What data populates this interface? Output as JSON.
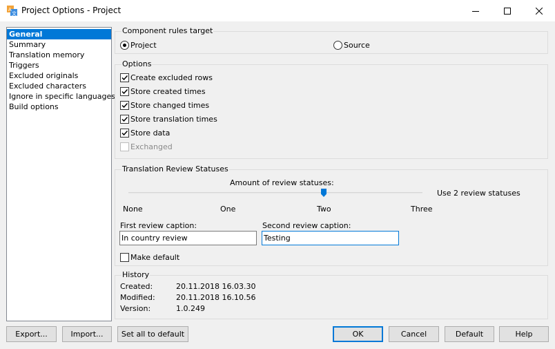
{
  "window": {
    "title": "Project Options - Project"
  },
  "nav": {
    "items": [
      "General",
      "Summary",
      "Translation memory",
      "Triggers",
      "Excluded originals",
      "Excluded characters",
      "Ignore in specific languages",
      "Build options"
    ],
    "selected_index": 0
  },
  "component_rules": {
    "title": "Component rules target",
    "options": [
      "Project",
      "Source"
    ],
    "selected": "Project"
  },
  "options": {
    "title": "Options",
    "items": [
      {
        "label": "Create excluded rows",
        "checked": true,
        "enabled": true
      },
      {
        "label": "Store created times",
        "checked": true,
        "enabled": true
      },
      {
        "label": "Store changed times",
        "checked": true,
        "enabled": true
      },
      {
        "label": "Store translation times",
        "checked": true,
        "enabled": true
      },
      {
        "label": "Store data",
        "checked": true,
        "enabled": true
      },
      {
        "label": "Exchanged",
        "checked": false,
        "enabled": false
      }
    ]
  },
  "review": {
    "title": "Translation Review Statuses",
    "slider_label": "Amount of review statuses:",
    "slider_value": 2,
    "slider_max": 3,
    "ticks": [
      "None",
      "One",
      "Two",
      "Three"
    ],
    "status_text": "Use 2 review statuses",
    "first_label": "First review caption:",
    "first_value": "In country review",
    "second_label": "Second review caption:",
    "second_value": "Testing",
    "make_default_label": "Make default",
    "make_default_checked": false
  },
  "history": {
    "title": "History",
    "created_label": "Created:",
    "created_value": "20.11.2018 16.03.30",
    "modified_label": "Modified:",
    "modified_value": "20.11.2018 16.10.56",
    "version_label": "Version:",
    "version_value": "1.0.249"
  },
  "buttons": {
    "export": "Export...",
    "import": "Import...",
    "set_all": "Set all to default",
    "ok": "OK",
    "cancel": "Cancel",
    "default": "Default",
    "help": "Help"
  },
  "colors": {
    "accent": "#0078d7",
    "window_bg": "#f0f0f0"
  }
}
